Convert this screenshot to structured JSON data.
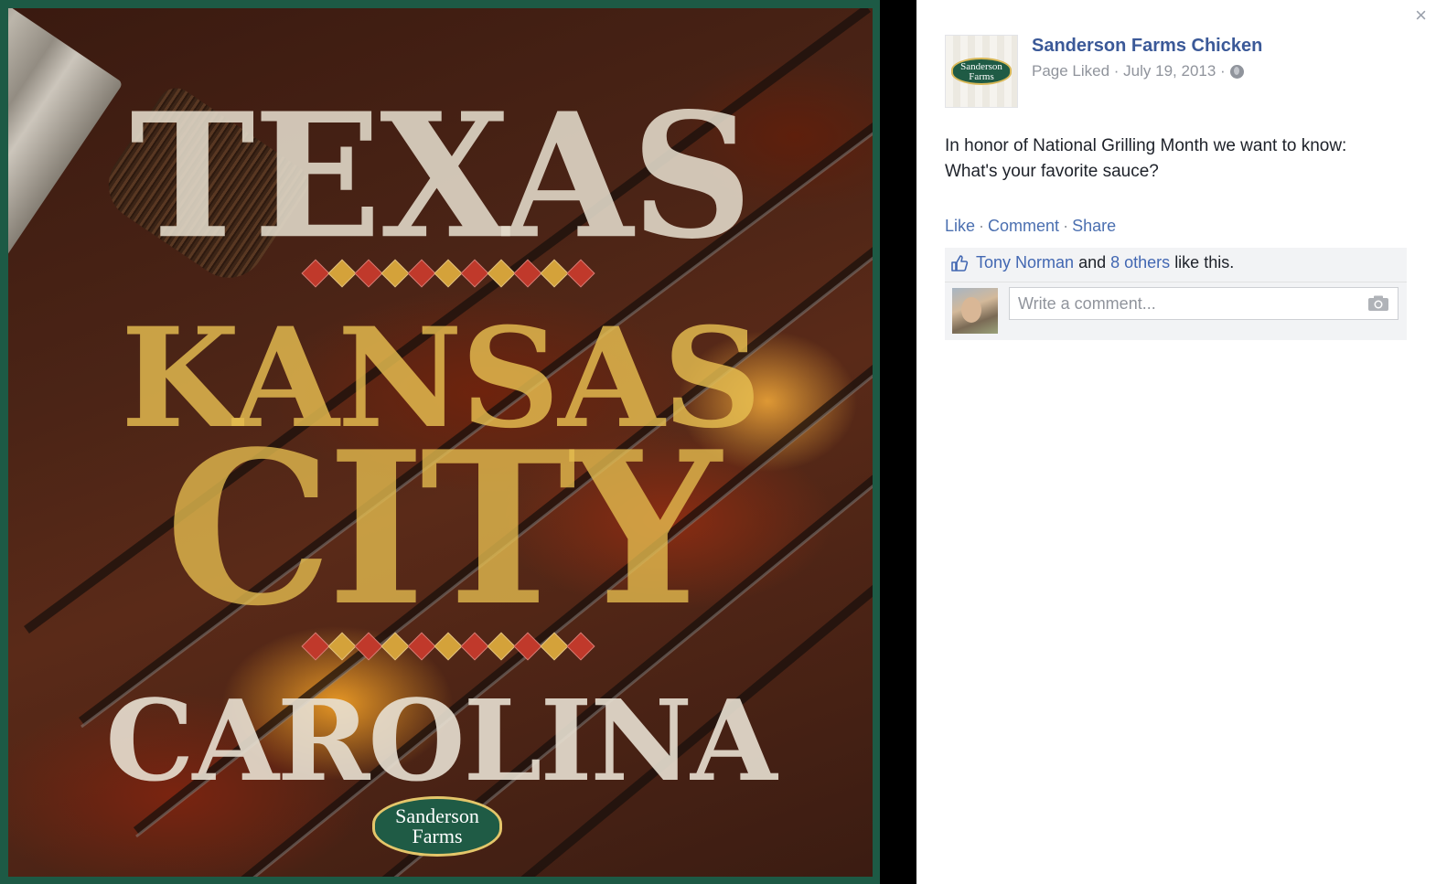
{
  "photo": {
    "words": {
      "top": "TEXAS",
      "middle1": "KANSAS",
      "middle2": "CITY",
      "bottom": "CAROLINA"
    },
    "logo": {
      "line1": "Sanderson",
      "line2": "Farms"
    },
    "diamond_colors": [
      "#c0392b",
      "#d4a23a"
    ]
  },
  "post": {
    "page_name": "Sanderson Farms Chicken",
    "page_avatar_text": {
      "line1": "Sanderson",
      "line2": "Farms"
    },
    "meta": "Page Liked · July 19, 2013 ·",
    "text_line1": "In honor of National Grilling Month we want to know:",
    "text_line2": "What's your favorite sauce?",
    "actions": {
      "like": "Like",
      "comment": "Comment",
      "share": "Share",
      "separator": "·"
    },
    "likes": {
      "person": "Tony Norman",
      "and": "and",
      "others": "8 others",
      "suffix": "like this."
    },
    "comment_placeholder": "Write a comment...",
    "close_label": "×"
  },
  "icons": [
    "close-icon",
    "globe-icon",
    "like-thumb-icon",
    "camera-icon"
  ],
  "colors": {
    "link": "#3b5998",
    "frame": "#1d5a45",
    "ufi_bg": "#f2f3f5",
    "muted": "#90949c"
  }
}
